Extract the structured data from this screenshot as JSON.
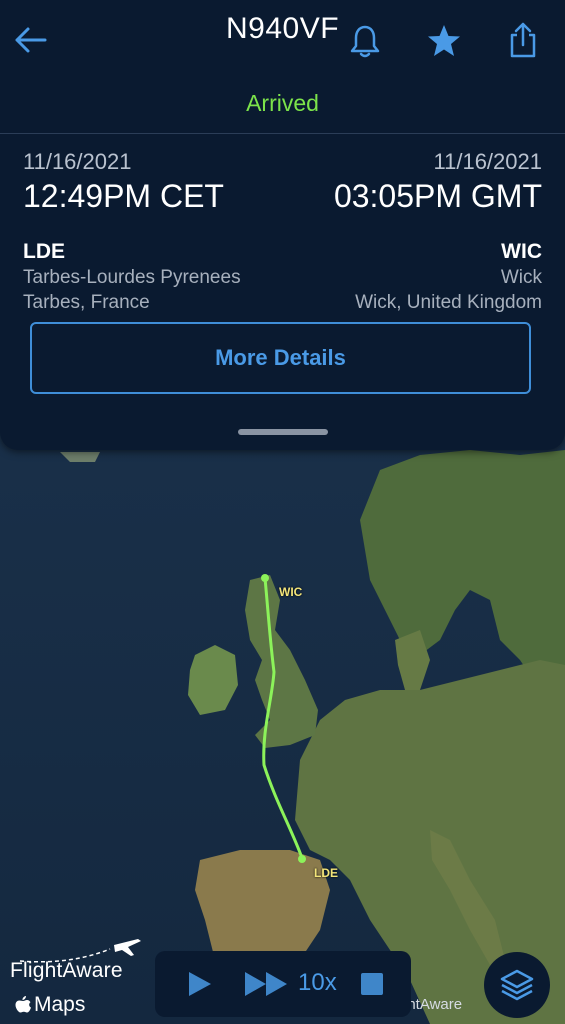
{
  "header": {
    "title": "N940VF",
    "status": "Arrived"
  },
  "departure": {
    "date": "11/16/2021",
    "time": "12:49PM CET",
    "code": "LDE",
    "airport": "Tarbes-Lourdes Pyrenees",
    "city": "Tarbes, France"
  },
  "arrival": {
    "date": "11/16/2021",
    "time": "03:05PM GMT",
    "code": "WIC",
    "airport": "Wick",
    "city": "Wick, United Kingdom"
  },
  "more_details_label": "More Details",
  "map": {
    "origin_label": "LDE",
    "destination_label": "WIC",
    "flightaware_logo_text": "FlightAware",
    "maps_credit": "Maps",
    "watermark": "ghtAware"
  },
  "playback": {
    "speed_label": "10x"
  },
  "colors": {
    "panel": "#0a1a30",
    "status_green": "#7ce34a",
    "accent_blue": "#4a9ae6",
    "route_green": "#8cf25a",
    "airport_label": "#f3e57a"
  },
  "icons": {
    "back": "arrow-left-icon",
    "alert": "bell-icon",
    "favorite": "star-icon",
    "share": "share-icon",
    "play": "play-icon",
    "fast_forward": "fast-forward-icon",
    "stop": "stop-icon",
    "layers": "layers-icon"
  }
}
